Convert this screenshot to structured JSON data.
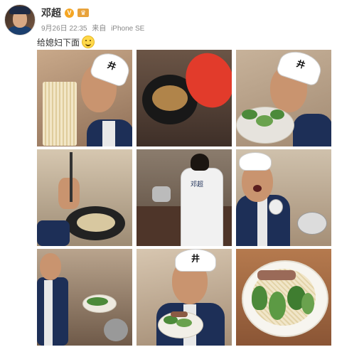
{
  "post": {
    "user": "邓超",
    "time": "9月26日 22:35",
    "source_prefix": "来自",
    "device": "iPhone SE",
    "caption": "给媳妇下面"
  },
  "icons": {
    "verified": "verified-v-icon",
    "member": "member-crown-icon",
    "caption_emoji": "grinning-emoji-icon"
  },
  "badge_text": {
    "verified": "V",
    "member": "♛"
  },
  "photos": [
    {
      "name": "photo-holding-noodles",
      "cap_text": "井"
    },
    {
      "name": "photo-pot-broth"
    },
    {
      "name": "photo-bok-choy",
      "cap_text": "井"
    },
    {
      "name": "photo-noodles-in-pan"
    },
    {
      "name": "photo-cooking-kitchen",
      "jacket_text": "邓超"
    },
    {
      "name": "photo-surprised-at-stove"
    },
    {
      "name": "photo-plating-veg"
    },
    {
      "name": "photo-holding-bowl",
      "cap_text": "井"
    },
    {
      "name": "photo-finished-bowl"
    }
  ],
  "colors": {
    "verified": "#f5a623",
    "member": "#e8a23a",
    "meta_text": "#888888"
  }
}
